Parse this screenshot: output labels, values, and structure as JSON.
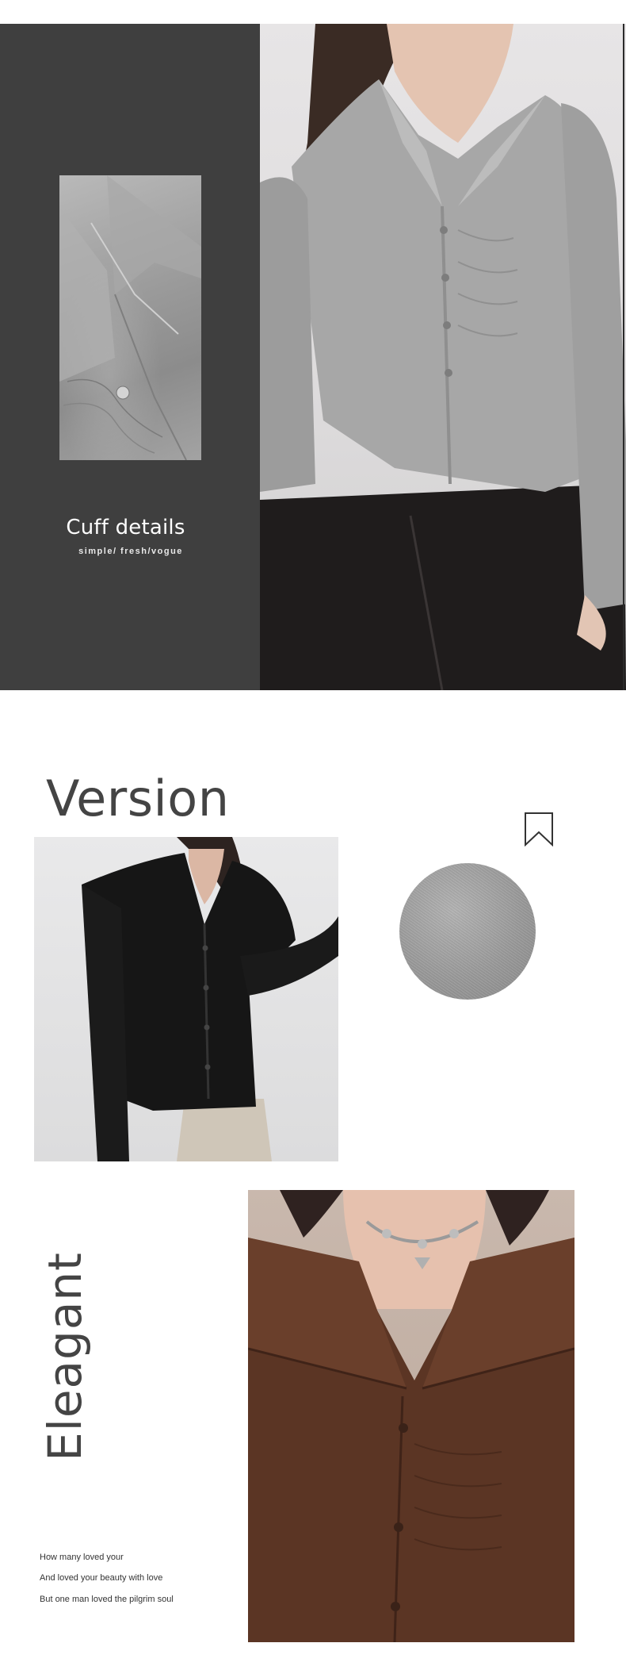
{
  "section_cuff": {
    "title": "Cuff details",
    "subtitle": "simple/ fresh/vogue"
  },
  "section_version": {
    "title": "Version",
    "icon": "bookmark-icon"
  },
  "section_elegant": {
    "title": "Eleagant",
    "poem": [
      "How many loved your",
      "And loved your beauty with love",
      "But one man loved the pilgrim soul"
    ]
  },
  "colors": {
    "dark_panel": "#3f3f3f",
    "heading_text": "#444444",
    "fabric_grey": "#9e9e9e",
    "fabric_brown": "#5b3524"
  }
}
